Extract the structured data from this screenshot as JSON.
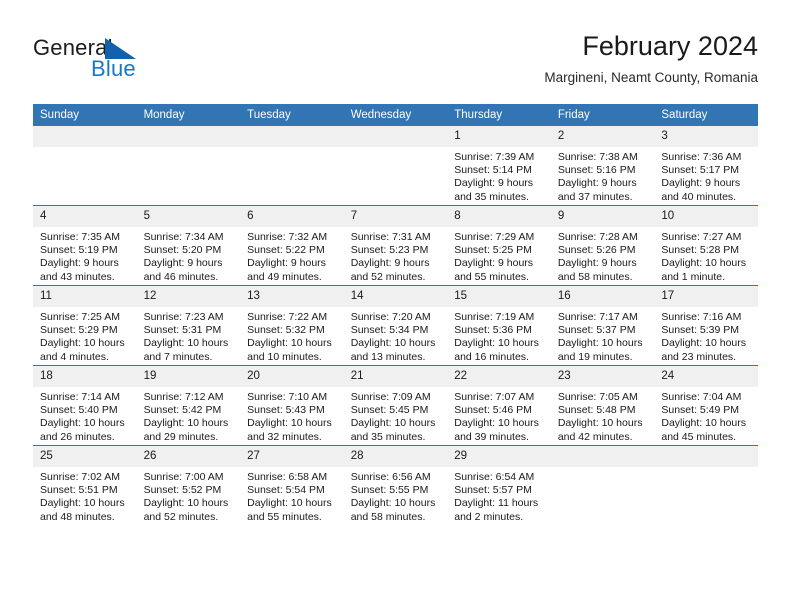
{
  "brand": {
    "name_part1": "General",
    "name_part2": "Blue",
    "mark": "triangle-logo-icon"
  },
  "header": {
    "title": "February 2024",
    "subtitle": "Margineni, Neamt County, Romania"
  },
  "colors": {
    "header_blue": "#3175b4",
    "brand_blue": "#1878c8",
    "daynum_band": "#f0f0f0",
    "text": "#1a1a1a"
  },
  "weekday_headers": [
    "Sunday",
    "Monday",
    "Tuesday",
    "Wednesday",
    "Thursday",
    "Friday",
    "Saturday"
  ],
  "weeks": [
    [
      {
        "day": "",
        "sunrise": "",
        "sunset": "",
        "daylight": "",
        "blank": true
      },
      {
        "day": "",
        "sunrise": "",
        "sunset": "",
        "daylight": "",
        "blank": true
      },
      {
        "day": "",
        "sunrise": "",
        "sunset": "",
        "daylight": "",
        "blank": true
      },
      {
        "day": "",
        "sunrise": "",
        "sunset": "",
        "daylight": "",
        "blank": true
      },
      {
        "day": "1",
        "sunrise": "Sunrise: 7:39 AM",
        "sunset": "Sunset: 5:14 PM",
        "daylight": "Daylight: 9 hours and 35 minutes."
      },
      {
        "day": "2",
        "sunrise": "Sunrise: 7:38 AM",
        "sunset": "Sunset: 5:16 PM",
        "daylight": "Daylight: 9 hours and 37 minutes."
      },
      {
        "day": "3",
        "sunrise": "Sunrise: 7:36 AM",
        "sunset": "Sunset: 5:17 PM",
        "daylight": "Daylight: 9 hours and 40 minutes."
      }
    ],
    [
      {
        "day": "4",
        "sunrise": "Sunrise: 7:35 AM",
        "sunset": "Sunset: 5:19 PM",
        "daylight": "Daylight: 9 hours and 43 minutes."
      },
      {
        "day": "5",
        "sunrise": "Sunrise: 7:34 AM",
        "sunset": "Sunset: 5:20 PM",
        "daylight": "Daylight: 9 hours and 46 minutes."
      },
      {
        "day": "6",
        "sunrise": "Sunrise: 7:32 AM",
        "sunset": "Sunset: 5:22 PM",
        "daylight": "Daylight: 9 hours and 49 minutes."
      },
      {
        "day": "7",
        "sunrise": "Sunrise: 7:31 AM",
        "sunset": "Sunset: 5:23 PM",
        "daylight": "Daylight: 9 hours and 52 minutes."
      },
      {
        "day": "8",
        "sunrise": "Sunrise: 7:29 AM",
        "sunset": "Sunset: 5:25 PM",
        "daylight": "Daylight: 9 hours and 55 minutes."
      },
      {
        "day": "9",
        "sunrise": "Sunrise: 7:28 AM",
        "sunset": "Sunset: 5:26 PM",
        "daylight": "Daylight: 9 hours and 58 minutes."
      },
      {
        "day": "10",
        "sunrise": "Sunrise: 7:27 AM",
        "sunset": "Sunset: 5:28 PM",
        "daylight": "Daylight: 10 hours and 1 minute."
      }
    ],
    [
      {
        "day": "11",
        "sunrise": "Sunrise: 7:25 AM",
        "sunset": "Sunset: 5:29 PM",
        "daylight": "Daylight: 10 hours and 4 minutes."
      },
      {
        "day": "12",
        "sunrise": "Sunrise: 7:23 AM",
        "sunset": "Sunset: 5:31 PM",
        "daylight": "Daylight: 10 hours and 7 minutes."
      },
      {
        "day": "13",
        "sunrise": "Sunrise: 7:22 AM",
        "sunset": "Sunset: 5:32 PM",
        "daylight": "Daylight: 10 hours and 10 minutes."
      },
      {
        "day": "14",
        "sunrise": "Sunrise: 7:20 AM",
        "sunset": "Sunset: 5:34 PM",
        "daylight": "Daylight: 10 hours and 13 minutes."
      },
      {
        "day": "15",
        "sunrise": "Sunrise: 7:19 AM",
        "sunset": "Sunset: 5:36 PM",
        "daylight": "Daylight: 10 hours and 16 minutes."
      },
      {
        "day": "16",
        "sunrise": "Sunrise: 7:17 AM",
        "sunset": "Sunset: 5:37 PM",
        "daylight": "Daylight: 10 hours and 19 minutes."
      },
      {
        "day": "17",
        "sunrise": "Sunrise: 7:16 AM",
        "sunset": "Sunset: 5:39 PM",
        "daylight": "Daylight: 10 hours and 23 minutes."
      }
    ],
    [
      {
        "day": "18",
        "sunrise": "Sunrise: 7:14 AM",
        "sunset": "Sunset: 5:40 PM",
        "daylight": "Daylight: 10 hours and 26 minutes."
      },
      {
        "day": "19",
        "sunrise": "Sunrise: 7:12 AM",
        "sunset": "Sunset: 5:42 PM",
        "daylight": "Daylight: 10 hours and 29 minutes."
      },
      {
        "day": "20",
        "sunrise": "Sunrise: 7:10 AM",
        "sunset": "Sunset: 5:43 PM",
        "daylight": "Daylight: 10 hours and 32 minutes."
      },
      {
        "day": "21",
        "sunrise": "Sunrise: 7:09 AM",
        "sunset": "Sunset: 5:45 PM",
        "daylight": "Daylight: 10 hours and 35 minutes."
      },
      {
        "day": "22",
        "sunrise": "Sunrise: 7:07 AM",
        "sunset": "Sunset: 5:46 PM",
        "daylight": "Daylight: 10 hours and 39 minutes."
      },
      {
        "day": "23",
        "sunrise": "Sunrise: 7:05 AM",
        "sunset": "Sunset: 5:48 PM",
        "daylight": "Daylight: 10 hours and 42 minutes."
      },
      {
        "day": "24",
        "sunrise": "Sunrise: 7:04 AM",
        "sunset": "Sunset: 5:49 PM",
        "daylight": "Daylight: 10 hours and 45 minutes."
      }
    ],
    [
      {
        "day": "25",
        "sunrise": "Sunrise: 7:02 AM",
        "sunset": "Sunset: 5:51 PM",
        "daylight": "Daylight: 10 hours and 48 minutes."
      },
      {
        "day": "26",
        "sunrise": "Sunrise: 7:00 AM",
        "sunset": "Sunset: 5:52 PM",
        "daylight": "Daylight: 10 hours and 52 minutes."
      },
      {
        "day": "27",
        "sunrise": "Sunrise: 6:58 AM",
        "sunset": "Sunset: 5:54 PM",
        "daylight": "Daylight: 10 hours and 55 minutes."
      },
      {
        "day": "28",
        "sunrise": "Sunrise: 6:56 AM",
        "sunset": "Sunset: 5:55 PM",
        "daylight": "Daylight: 10 hours and 58 minutes."
      },
      {
        "day": "29",
        "sunrise": "Sunrise: 6:54 AM",
        "sunset": "Sunset: 5:57 PM",
        "daylight": "Daylight: 11 hours and 2 minutes."
      },
      {
        "day": "",
        "sunrise": "",
        "sunset": "",
        "daylight": "",
        "blank": true
      },
      {
        "day": "",
        "sunrise": "",
        "sunset": "",
        "daylight": "",
        "blank": true
      }
    ]
  ]
}
